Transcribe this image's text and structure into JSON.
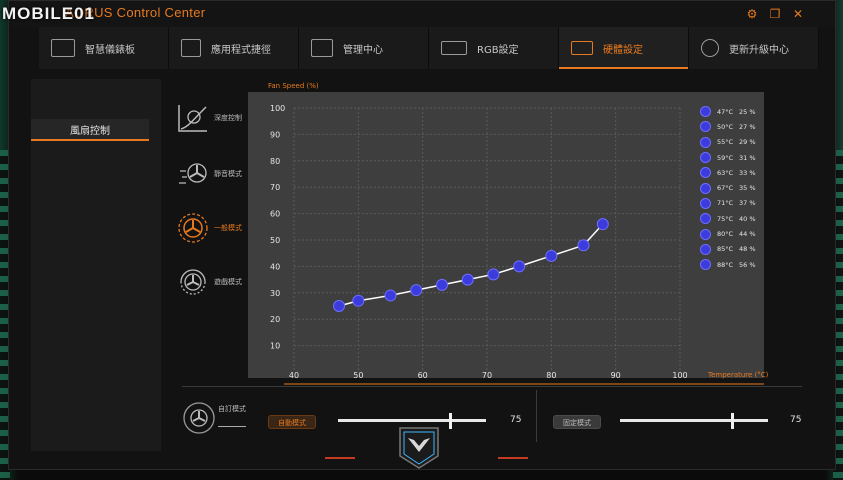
{
  "watermark": "MOBILE01",
  "app": {
    "title": "AORUS Control Center"
  },
  "window_controls": {
    "settings": "⚙",
    "restore": "❐",
    "close": "✕"
  },
  "tabs": [
    {
      "label": "智慧儀錶板",
      "icon": "dashboard-icon"
    },
    {
      "label": "應用程式捷徑",
      "icon": "app-shortcut-icon"
    },
    {
      "label": "管理中心",
      "icon": "management-icon"
    },
    {
      "label": "RGB設定",
      "icon": "keyboard-icon"
    },
    {
      "label": "硬體設定",
      "icon": "laptop-settings-icon"
    },
    {
      "label": "更新升級中心",
      "icon": "update-icon"
    }
  ],
  "active_tab": "硬體設定",
  "sidebar": {
    "items": [
      {
        "label": "風扇控制"
      }
    ]
  },
  "modes": [
    {
      "label": "深度控制",
      "icon": "deep-control-icon"
    },
    {
      "label": "靜音模式",
      "icon": "silent-fan-icon"
    },
    {
      "label": "一般模式",
      "icon": "normal-fan-icon"
    },
    {
      "label": "遊戲模式",
      "icon": "gaming-fan-icon"
    }
  ],
  "active_mode": "一般模式",
  "chart_data": {
    "type": "line",
    "ylabel": "Fan Speed (%)",
    "xlabel": "Temperature (°C)",
    "xlim": [
      40,
      100
    ],
    "ylim": [
      0,
      100
    ],
    "x_ticks": [
      40,
      50,
      60,
      70,
      80,
      90,
      100
    ],
    "y_ticks": [
      10,
      20,
      30,
      40,
      50,
      60,
      70,
      80,
      90,
      100
    ],
    "grid": true,
    "series": [
      {
        "x": [
          47,
          50,
          55,
          59,
          63,
          67,
          71,
          75,
          80,
          85,
          88
        ],
        "values": [
          25,
          27,
          29,
          31,
          33,
          35,
          37,
          40,
          44,
          48,
          56
        ]
      }
    ],
    "colors": {
      "point": "#3c3cdc",
      "line": "#ffffff",
      "plot_bg": "#3e3e3e",
      "accent": "#e77a1e"
    }
  },
  "legend": [
    {
      "temp": "47°C",
      "speed": "25 %"
    },
    {
      "temp": "50°C",
      "speed": "27 %"
    },
    {
      "temp": "55°C",
      "speed": "29 %"
    },
    {
      "temp": "59°C",
      "speed": "31 %"
    },
    {
      "temp": "63°C",
      "speed": "33 %"
    },
    {
      "temp": "67°C",
      "speed": "35 %"
    },
    {
      "temp": "71°C",
      "speed": "37 %"
    },
    {
      "temp": "75°C",
      "speed": "40 %"
    },
    {
      "temp": "80°C",
      "speed": "44 %"
    },
    {
      "temp": "85°C",
      "speed": "48 %"
    },
    {
      "temp": "88°C",
      "speed": "56 %"
    }
  ],
  "bottom": {
    "custom_mode_label": "自訂模式",
    "auto_mode": {
      "label": "自動模式",
      "value": "75",
      "fraction": 0.75
    },
    "fixed_mode": {
      "label": "固定模式",
      "value": "75",
      "fraction": 0.75
    }
  }
}
